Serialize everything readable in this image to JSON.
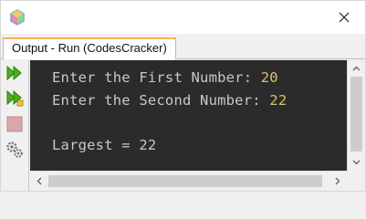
{
  "window": {
    "title_icon": "app-cube-icon",
    "close_icon": "close-icon"
  },
  "tab": {
    "label": "Output - Run (CodesCracker)"
  },
  "toolbar": {
    "items": [
      {
        "name": "rerun-icon"
      },
      {
        "name": "rerun-with-params-icon"
      },
      {
        "name": "stop-icon"
      },
      {
        "name": "settings-icon"
      }
    ]
  },
  "console": {
    "line1_label": "Enter the First Number: ",
    "line1_value": "20",
    "line2_label": "Enter the Second Number: ",
    "line2_value": "22",
    "line3": "Largest = 22"
  },
  "colors": {
    "console_bg": "#2b2b2b",
    "console_text": "#c8c8c8",
    "input_value": "#d9c36a",
    "run_icon_green": "#4caf1e",
    "tab_accent": "#f5b45a"
  }
}
